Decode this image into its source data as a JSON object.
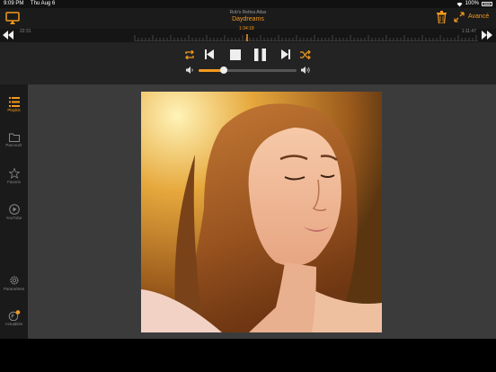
{
  "status": {
    "time": "9:09 PM",
    "date": "Thu Aug 6",
    "battery": "100%"
  },
  "header": {
    "subtitle": "Rob's Retina Atlas",
    "title": "Daydreams",
    "advanced_label": "Avancé"
  },
  "timeline": {
    "elapsed": "22:31",
    "current": "1:34:18",
    "total": "1:11:47"
  },
  "volume": {
    "level": 0.26
  },
  "sidebar": {
    "items": [
      {
        "label": "Playlist",
        "icon": "list-icon",
        "active": true
      },
      {
        "label": "Parcourir",
        "icon": "folder-icon",
        "active": false
      },
      {
        "label": "Favoris",
        "icon": "star-icon",
        "active": false
      },
      {
        "label": "YouTube",
        "icon": "youtube-icon",
        "active": false
      },
      {
        "label": "Paramètres",
        "icon": "gear-icon",
        "active": false
      },
      {
        "label": "Actualités",
        "icon": "news-icon",
        "active": false
      }
    ]
  },
  "colors": {
    "accent": "#f39a1e",
    "background": "#3b3b3b",
    "sidebar": "#1a1a1a"
  }
}
